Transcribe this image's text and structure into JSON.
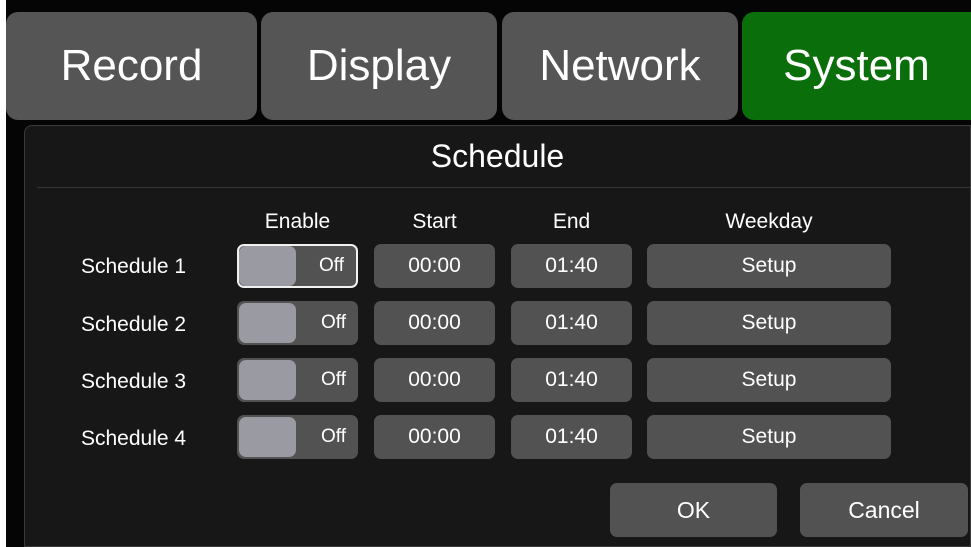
{
  "tabs": [
    {
      "label": "Record",
      "active": false
    },
    {
      "label": "Display",
      "active": false
    },
    {
      "label": "Network",
      "active": false
    },
    {
      "label": "System",
      "active": true
    }
  ],
  "panel": {
    "title": "Schedule",
    "columns": {
      "enable": "Enable",
      "start": "Start",
      "end": "End",
      "weekday": "Weekday"
    },
    "rows": [
      {
        "label": "Schedule 1",
        "enable": "Off",
        "start": "00:00",
        "end": "01:40",
        "weekday": "Setup"
      },
      {
        "label": "Schedule 2",
        "enable": "Off",
        "start": "00:00",
        "end": "01:40",
        "weekday": "Setup"
      },
      {
        "label": "Schedule 3",
        "enable": "Off",
        "start": "00:00",
        "end": "01:40",
        "weekday": "Setup"
      },
      {
        "label": "Schedule 4",
        "enable": "Off",
        "start": "00:00",
        "end": "01:40",
        "weekday": "Setup"
      }
    ]
  },
  "buttons": {
    "ok": "OK",
    "cancel": "Cancel"
  },
  "colors": {
    "active_tab": "#0a6f0a",
    "tab": "#555555",
    "field": "#525252",
    "background": "#050505"
  }
}
